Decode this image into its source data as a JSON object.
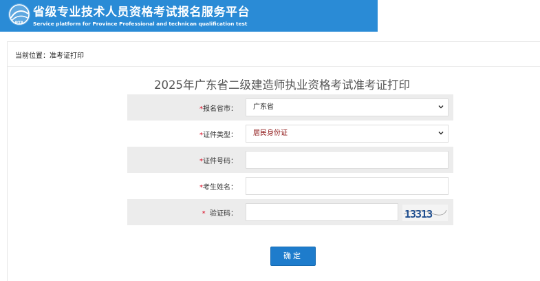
{
  "header": {
    "title_cn": "省级专业技术人员资格考试报名服务平台",
    "title_en": "Service platform for Province Professional and technican qualification test",
    "logo_icon": "pta-logo-icon",
    "band_color": "#2a8bd6"
  },
  "breadcrumb": {
    "text": "当前位置：准考证打印"
  },
  "page_title": "2025年广东省二级建造师执业资格考试准考证打印",
  "form": {
    "required_mark": "*",
    "province": {
      "label": "报名省市：",
      "value": "广东省",
      "icon": "chevron-down-icon"
    },
    "id_type": {
      "label": "证件类型：",
      "value": "居民身份证",
      "icon": "chevron-down-icon"
    },
    "id_number": {
      "label": "证件号码：",
      "value": "",
      "placeholder": ""
    },
    "name": {
      "label": "考生姓名：",
      "value": "",
      "placeholder": ""
    },
    "captcha": {
      "label": "验证码：",
      "value": "",
      "placeholder": "",
      "image_text": "13313"
    }
  },
  "submit_label": "确定",
  "colors": {
    "accent": "#1e7ccc",
    "required": "#d9001b"
  }
}
